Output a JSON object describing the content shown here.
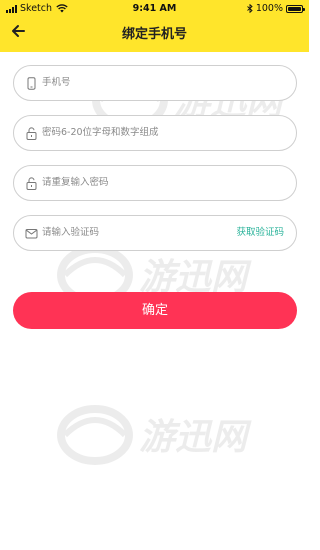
{
  "status_bar": {
    "carrier": "Sketch",
    "time": "9:41 AM",
    "battery": "100%",
    "battery_level": 1.0,
    "icons": [
      "signal-icon",
      "wifi-icon",
      "bluetooth-icon",
      "battery-icon"
    ]
  },
  "header": {
    "title": "绑定手机号",
    "back_icon": "back-arrow-icon",
    "background": "#FFE52B"
  },
  "form": {
    "phone_placeholder": "手机号",
    "password_placeholder": "密码6-20位字母和数字组成",
    "confirm_password_placeholder": "请重复输入密码",
    "code_placeholder": "请输入验证码",
    "get_code_label": "获取验证码",
    "submit_label": "确定"
  },
  "watermark": {
    "text": "游迅网"
  },
  "colors": {
    "accent_yellow": "#FFE52B",
    "submit_red": "#FF3355",
    "link_green": "#2ab39a",
    "border_gray": "#cfcfcf",
    "placeholder_gray": "#8a8a8a"
  }
}
